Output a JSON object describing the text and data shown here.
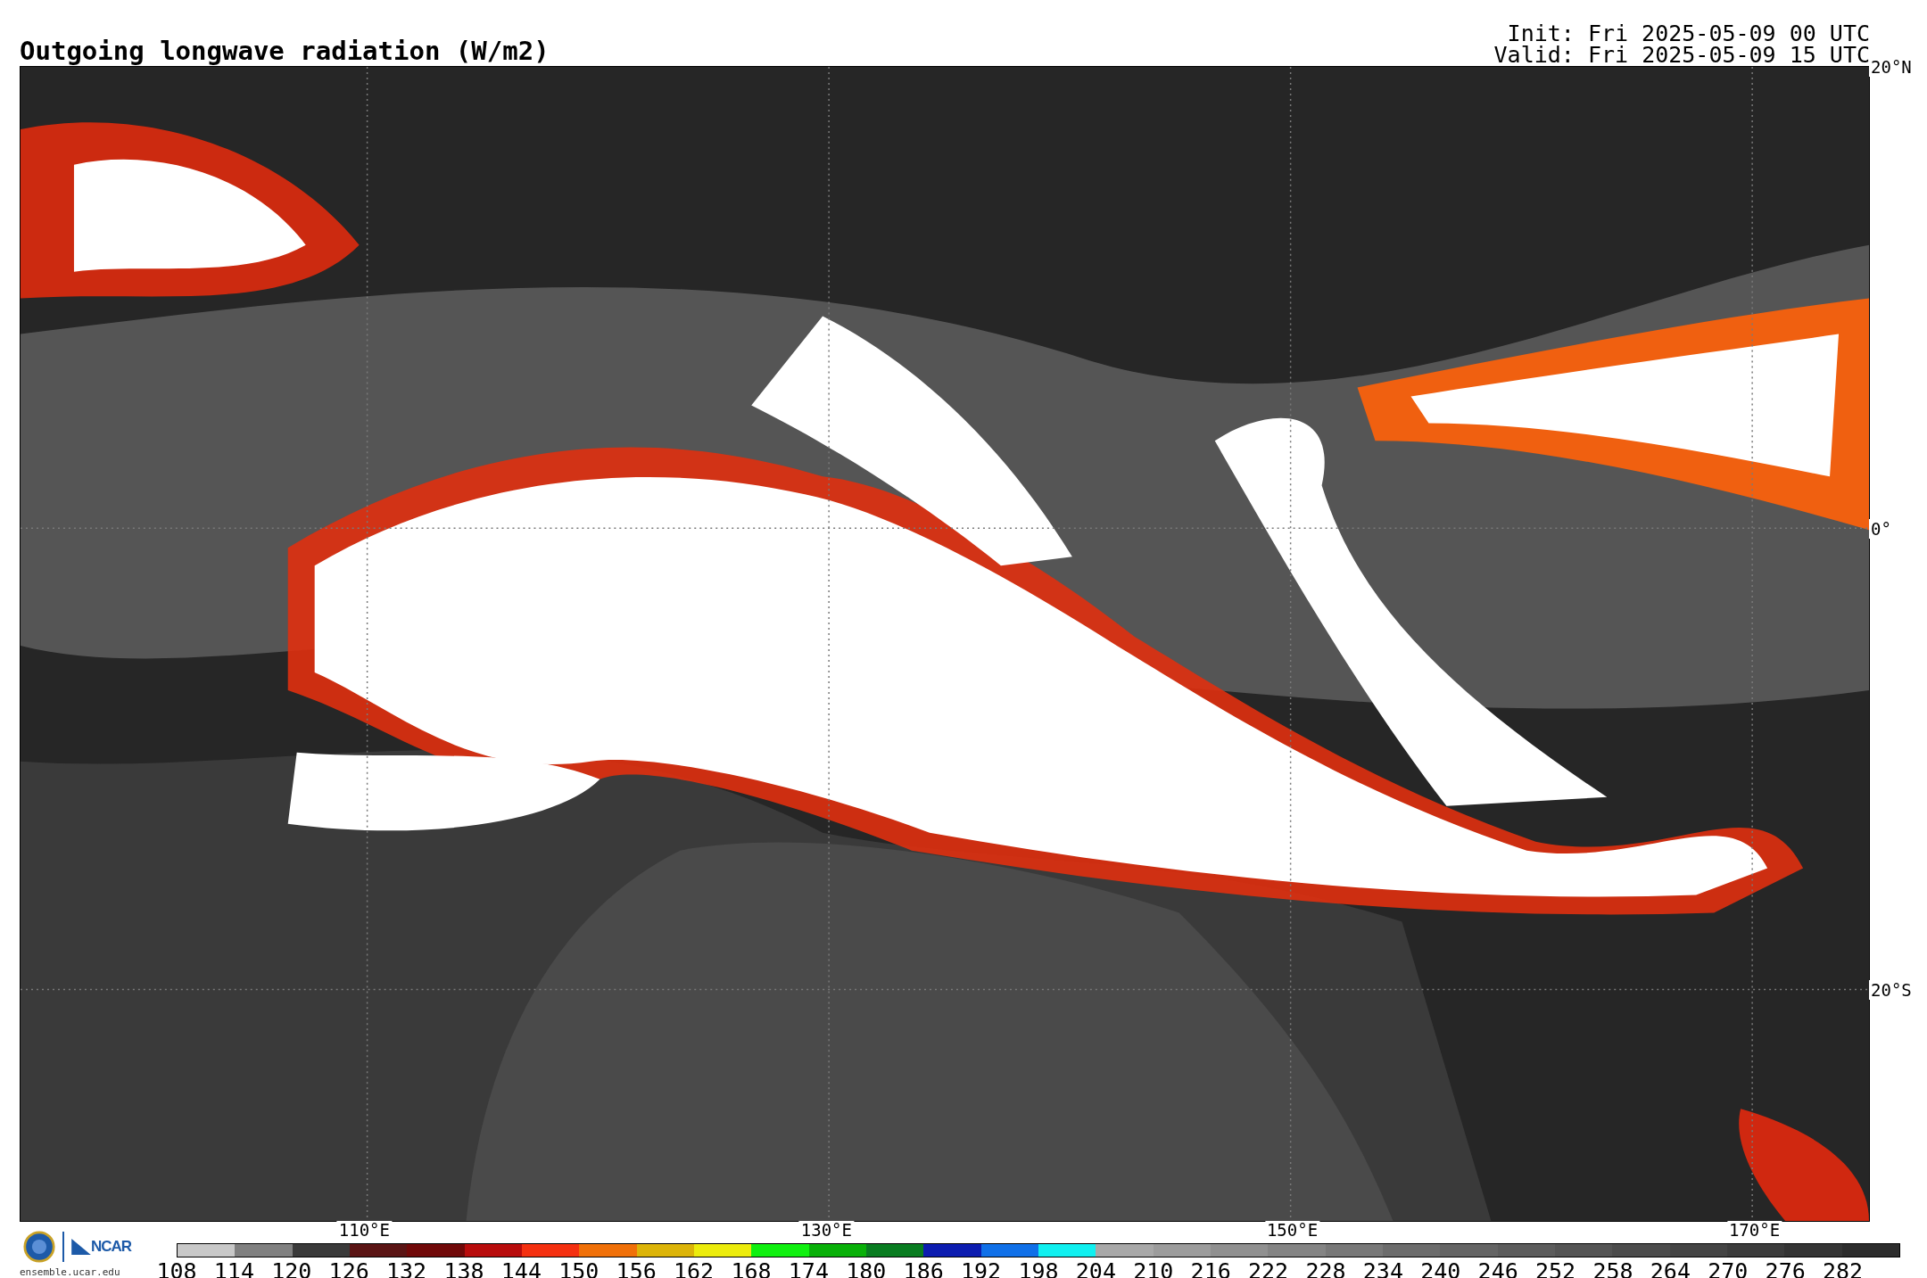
{
  "title": "Outgoing longwave radiation (W/m2)",
  "init": "Init: Fri 2025-05-09 00 UTC",
  "valid": "Valid: Fri 2025-05-09 15 UTC",
  "map": {
    "lat_labels": [
      "20°N",
      "0°",
      "20°S"
    ],
    "lon_labels": [
      "110°E",
      "130°E",
      "150°E",
      "170°E"
    ]
  },
  "footer": {
    "org": "NCAR",
    "site": "ensemble.ucar.edu"
  },
  "colorbar": {
    "bins": [
      {
        "color": "#c8c8c8"
      },
      {
        "color": "#808080"
      },
      {
        "color": "#3a3a3a"
      },
      {
        "color": "#5a1414"
      },
      {
        "color": "#700808"
      },
      {
        "color": "#b80c0c"
      },
      {
        "color": "#f43010"
      },
      {
        "color": "#f07008"
      },
      {
        "color": "#dcb408"
      },
      {
        "color": "#ecec0c"
      },
      {
        "color": "#10f010"
      },
      {
        "color": "#08b008"
      },
      {
        "color": "#087c20"
      },
      {
        "color": "#0c1cb0"
      },
      {
        "color": "#1070e8"
      },
      {
        "color": "#10f0f0"
      },
      {
        "color": "#a8a8a8"
      },
      {
        "color": "#9c9c9c"
      },
      {
        "color": "#909090"
      },
      {
        "color": "#848484"
      },
      {
        "color": "#787878"
      },
      {
        "color": "#6c6c6c"
      },
      {
        "color": "#646464"
      },
      {
        "color": "#5c5c5c"
      },
      {
        "color": "#545454"
      },
      {
        "color": "#4c4c4c"
      },
      {
        "color": "#444444"
      },
      {
        "color": "#3c3c3c"
      },
      {
        "color": "#343434"
      },
      {
        "color": "#2c2c2c"
      }
    ],
    "labels": [
      "108",
      "114",
      "120",
      "126",
      "132",
      "138",
      "144",
      "150",
      "156",
      "162",
      "168",
      "174",
      "180",
      "186",
      "192",
      "198",
      "204",
      "210",
      "216",
      "222",
      "228",
      "234",
      "240",
      "246",
      "252",
      "258",
      "264",
      "270",
      "276",
      "282"
    ]
  }
}
